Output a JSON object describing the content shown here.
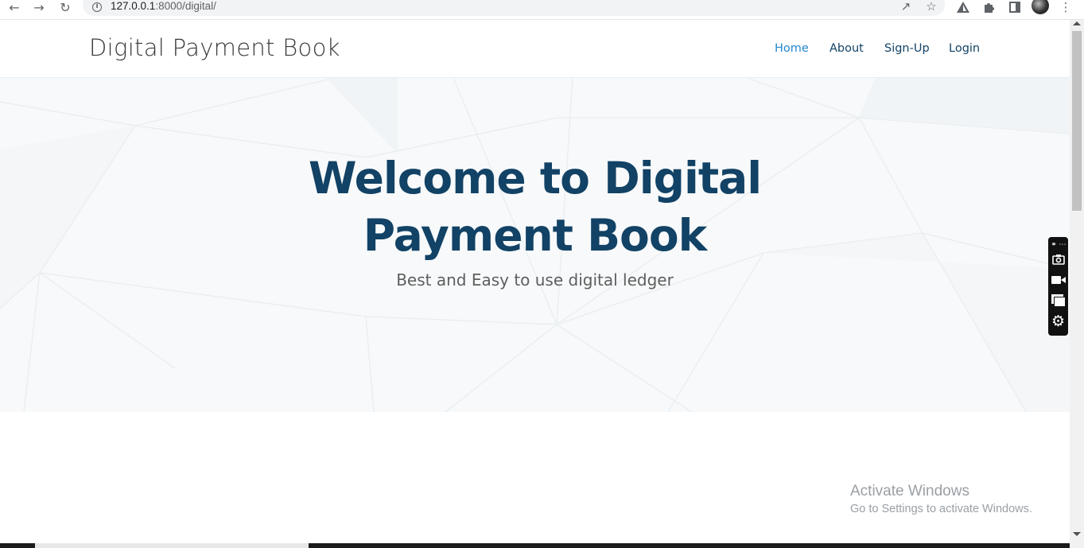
{
  "browser": {
    "url_host": "127.0.0.1",
    "url_path": ":8000/digital/",
    "icons": [
      "back-icon",
      "forward-icon",
      "reload-icon",
      "info-icon",
      "share-icon",
      "bookmark-star-icon",
      "extension-triangle-icon",
      "extensions-puzzle-icon",
      "side-panel-icon",
      "profile-avatar",
      "more-menu-icon"
    ]
  },
  "header": {
    "brand": "Digital Payment Book",
    "nav": [
      {
        "label": "Home",
        "active": true
      },
      {
        "label": "About",
        "active": false
      },
      {
        "label": "Sign-Up",
        "active": false
      },
      {
        "label": "Login",
        "active": false
      }
    ]
  },
  "hero": {
    "title_line1": "Welcome to Digital",
    "title_line2": "Payment Book",
    "subtitle": "Best and Easy to use digital ledger"
  },
  "recorder": {
    "icons": [
      "link-icon",
      "more-icon",
      "camera-icon",
      "video-icon",
      "window-icon",
      "settings-gear-icon"
    ]
  },
  "activate_windows": {
    "title": "Activate Windows",
    "message": "Go to Settings to activate Windows."
  },
  "colors": {
    "brand_dark": "#124265",
    "accent_blue": "#2487ce"
  }
}
